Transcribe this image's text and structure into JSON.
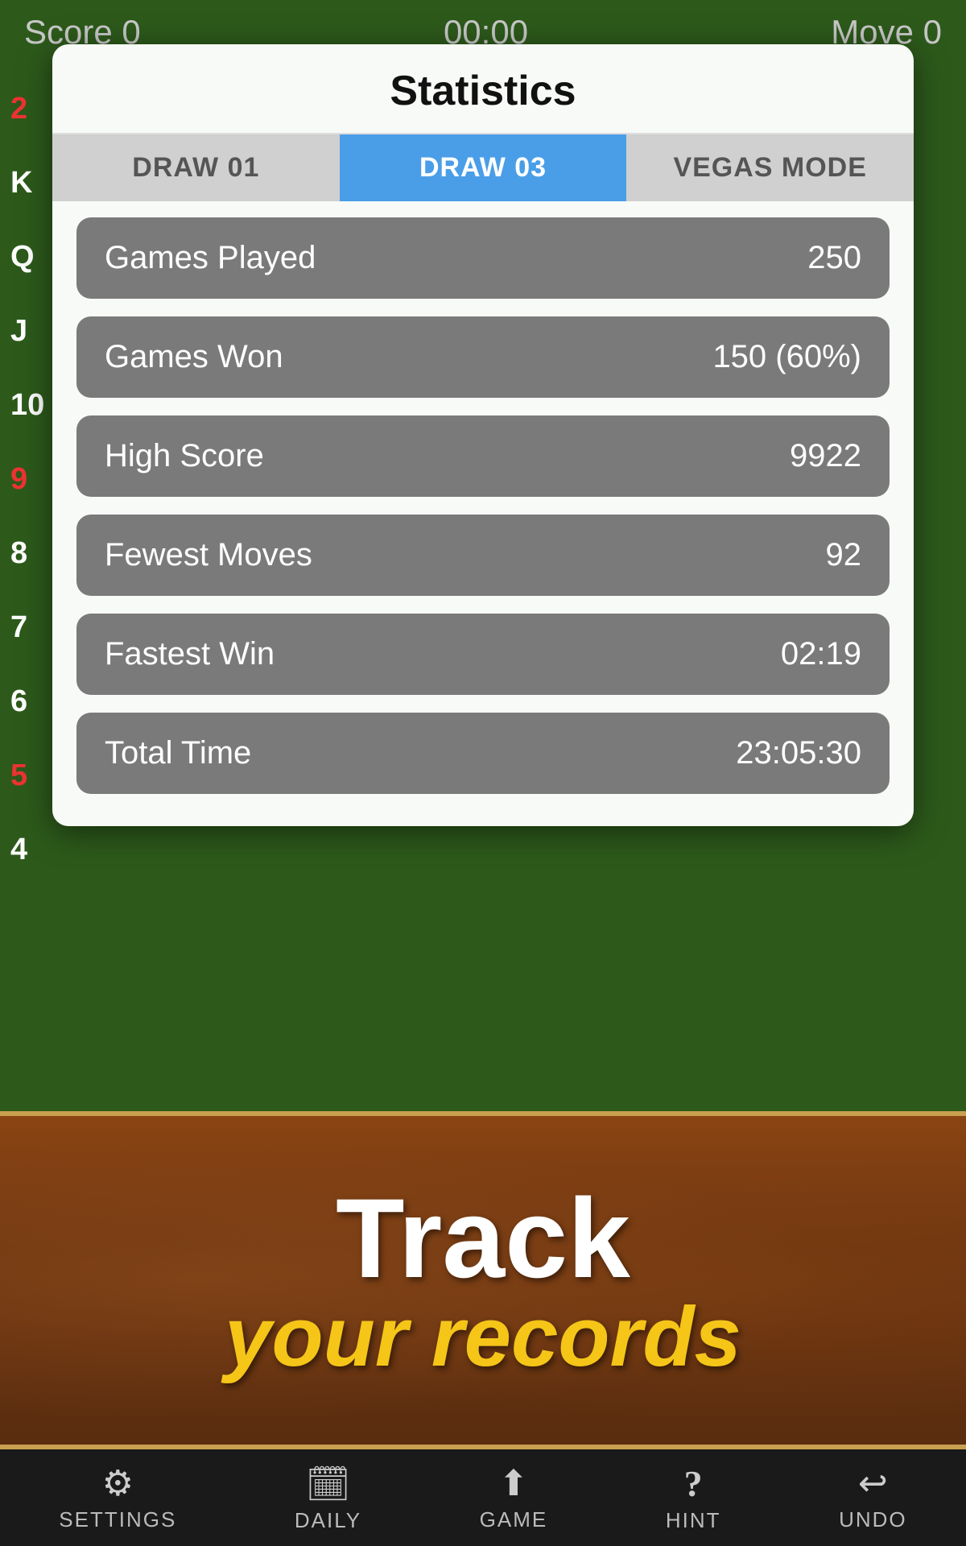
{
  "topBar": {
    "score_label": "Score 0",
    "timer_label": "00:00",
    "move_label": "Move 0"
  },
  "modal": {
    "title": "Statistics",
    "tabs": [
      {
        "id": "draw01",
        "label": "DRAW 01",
        "active": false
      },
      {
        "id": "draw03",
        "label": "DRAW 03",
        "active": true
      },
      {
        "id": "vegas",
        "label": "VEGAS MODE",
        "active": false
      }
    ],
    "stats": [
      {
        "label": "Games Played",
        "value": "250"
      },
      {
        "label": "Games Won",
        "value": "150 (60%)"
      },
      {
        "label": "High Score",
        "value": "9922"
      },
      {
        "label": "Fewest Moves",
        "value": "92"
      },
      {
        "label": "Fastest Win",
        "value": "02:19"
      },
      {
        "label": "Total Time",
        "value": "23:05:30"
      }
    ]
  },
  "banner": {
    "line1": "Track",
    "line2": "your records"
  },
  "bottomNav": [
    {
      "id": "settings",
      "icon": "⚙",
      "label": "SETTINGS"
    },
    {
      "id": "daily",
      "icon": "📅",
      "label": "DAILY"
    },
    {
      "id": "game",
      "icon": "⬆",
      "label": "GAME"
    },
    {
      "id": "hint",
      "icon": "?",
      "label": "HINT"
    },
    {
      "id": "undo",
      "icon": "↩",
      "label": "UNDO"
    }
  ],
  "leftCards": [
    "2",
    "K",
    "Q",
    "J",
    "10",
    "9",
    "8",
    "7",
    "6",
    "5",
    "4"
  ],
  "leftCardsRed": [
    true,
    false,
    false,
    false,
    false,
    true,
    false,
    false,
    false,
    true,
    false
  ]
}
